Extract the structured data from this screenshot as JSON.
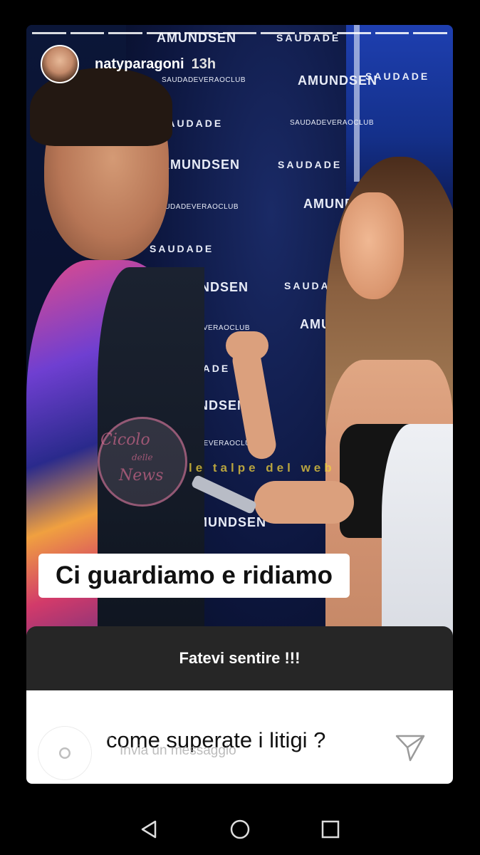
{
  "story": {
    "username": "natyparagoni",
    "time": "13h",
    "caption": "Ci guardiamo e ridiamo",
    "question_prompt": "Fatevi sentire !!!",
    "question_answer": "come superate i litigi ?",
    "reply_placeholder": "Invia un messaggio",
    "progress_segments": 11
  },
  "backdrop": {
    "brands": [
      "AMUNDSEN",
      "SAUDADE",
      "SAUDADEVERAOCLUB"
    ]
  },
  "watermarks": {
    "circle_text_1": "Cicolo",
    "circle_text_2": "delle",
    "circle_text_3": "News",
    "talpe": "le talpe del web"
  },
  "icons": {
    "camera": "camera-icon",
    "send": "send-icon",
    "back": "nav-back-icon",
    "home": "nav-home-icon",
    "recents": "nav-recents-icon"
  },
  "colors": {
    "background": "#000000",
    "question_header": "#262626",
    "caption_bg": "#ffffff"
  }
}
